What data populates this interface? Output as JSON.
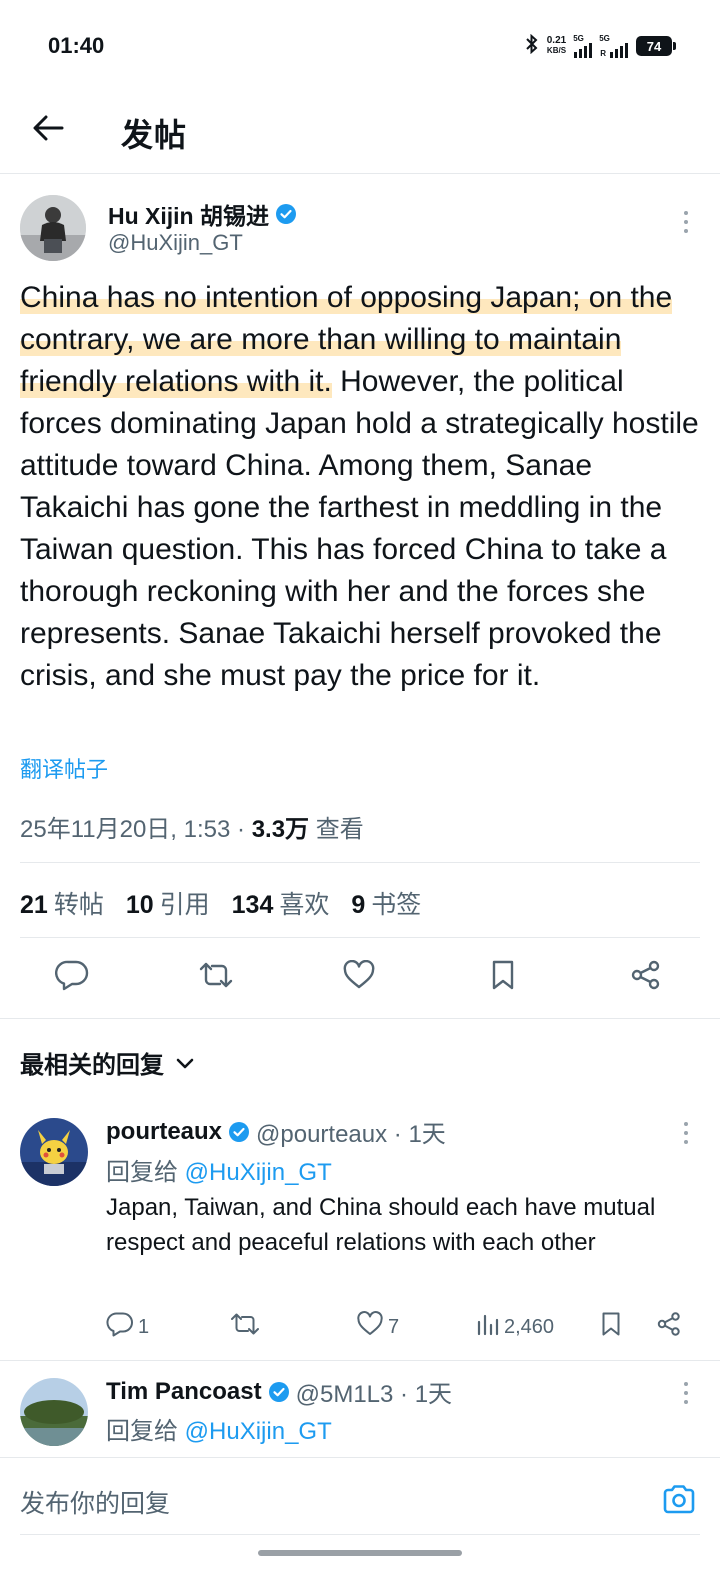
{
  "status_bar": {
    "time": "01:40",
    "net_speed_value": "0.21",
    "net_speed_unit": "KB/S",
    "sim1_tag": "5G",
    "sim2_tag": "5G",
    "sim2_sub": "R",
    "battery": "74"
  },
  "header": {
    "title": "发帖",
    "back_icon": "arrow-left-icon"
  },
  "tweet": {
    "author_name": "Hu Xijin 胡锡进",
    "author_handle": "@HuXijin_GT",
    "body_highlighted": "China has no intention of opposing Japan; on the contrary, we are more than willing to maintain friendly relations with it.",
    "body_rest": " However, the political forces dominating Japan hold a strategically hostile attitude toward China. Among them, Sanae Takaichi has gone the farthest in meddling in the Taiwan question. This has forced China to take a thorough reckoning with her and the forces she represents. Sanae Takaichi herself provoked the crisis, and she must pay the price for it.",
    "translate_label": "翻译帖子",
    "timestamp": "25年11月20日, 1:53 ·",
    "views_count": "3.3万",
    "views_label": "查看",
    "stats": {
      "reposts_count": "21",
      "reposts_label": "转帖",
      "quotes_count": "10",
      "quotes_label": "引用",
      "likes_count": "134",
      "likes_label": "喜欢",
      "bookmarks_count": "9",
      "bookmarks_label": "书签"
    },
    "accent_color": "#1d9bf0",
    "highlight_color": "#fdcb6e"
  },
  "replies_section": {
    "sort_label": "最相关的回复"
  },
  "replies": [
    {
      "name": "pourteaux",
      "handle": "@pourteaux · 1天",
      "reply_to_prefix": "回复给",
      "reply_to_handle": "@HuXijin_GT",
      "text": "Japan, Taiwan, and China should each have mutual respect and peaceful relations with each other",
      "reply_count": "1",
      "repost_count": "",
      "like_count": "7",
      "view_count": "2,460"
    },
    {
      "name": "Tim Pancoast",
      "handle": "@5M1L3 · 1天",
      "reply_to_prefix": "回复给",
      "reply_to_handle": "@HuXijin_GT"
    }
  ],
  "composer": {
    "placeholder": "发布你的回复",
    "camera_icon": "camera-icon"
  }
}
